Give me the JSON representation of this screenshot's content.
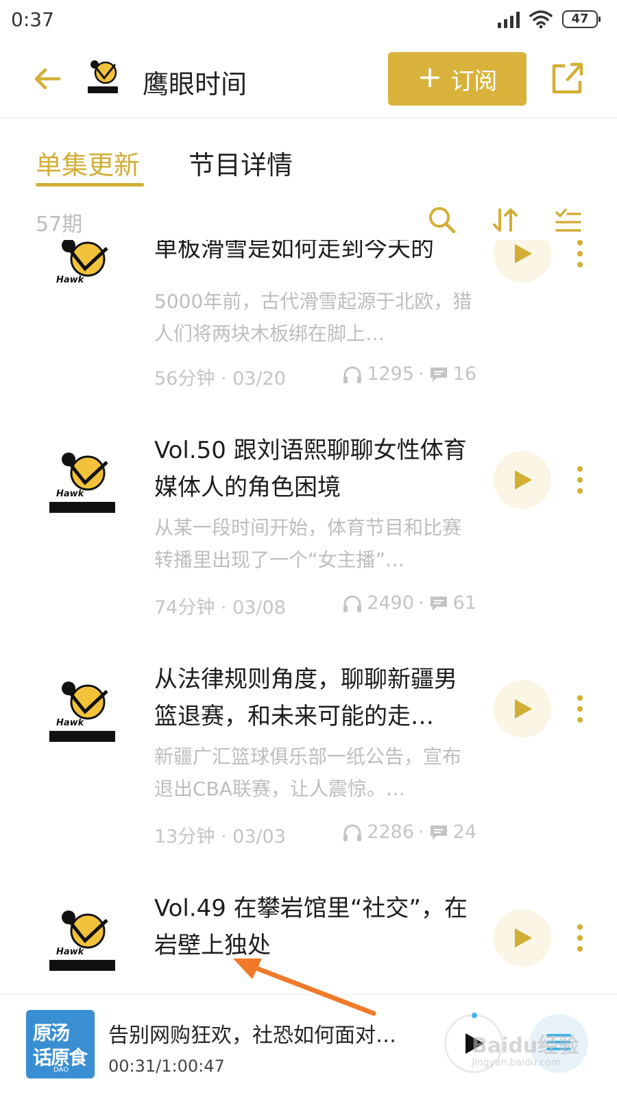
{
  "status_bar": {
    "time": "0:37",
    "battery": "47"
  },
  "header": {
    "title": "鹰眼时间",
    "subscribe_label": "订阅"
  },
  "tabs": [
    {
      "label": "单集更新",
      "active": true
    },
    {
      "label": "节目详情",
      "active": false
    }
  ],
  "toolbar": {
    "episode_count": "57期"
  },
  "episodes": [
    {
      "title": "单板滑雪是如何走到今天的",
      "description": "5000年前，古代滑雪起源于北欧，猎人们将两块木板绑在脚上…",
      "duration_date": "56分钟 · 03/20",
      "plays": "1295",
      "comments": "16"
    },
    {
      "title": "Vol.50 跟刘语熙聊聊女性体育媒体人的角色困境",
      "description": "从某一段时间开始，体育节目和比赛转播里出现了一个“女主播”…",
      "duration_date": "74分钟 · 03/08",
      "plays": "2490",
      "comments": "61"
    },
    {
      "title": "从法律规则角度，聊聊新疆男篮退赛，和未来可能的走…",
      "description": "新疆广汇篮球俱乐部一纸公告，宣布退出CBA联赛，让人震惊。…",
      "duration_date": "13分钟 · 03/03",
      "plays": "2286",
      "comments": "24"
    },
    {
      "title": "Vol.49 在攀岩馆里“社交”，在岩壁上独处",
      "description": "",
      "duration_date": "",
      "plays": "",
      "comments": ""
    }
  ],
  "player": {
    "title": "告别网购狂欢，社恐如何面对…",
    "time": "00:31/1:00:47",
    "cover_text_line1": "原汤",
    "cover_text_line2": "话原食",
    "cover_text_line3": "DAO"
  },
  "watermark": {
    "main": "Baidu经验",
    "sub": "jingyan.baidu.com"
  },
  "colors": {
    "accent": "#d2ae35",
    "button": "#d8b23a",
    "arrow": "#f07a2a"
  }
}
